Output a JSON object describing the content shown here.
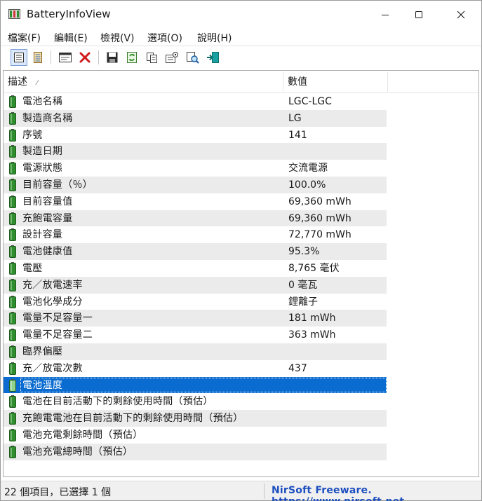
{
  "window": {
    "title": "BatteryInfoView",
    "app_icon": "battery-app-icon",
    "controls": [
      "minimize-icon",
      "maximize-icon",
      "close-icon"
    ]
  },
  "menu": {
    "items": [
      "檔案(F)",
      "編輯(E)",
      "檢視(V)",
      "選項(O)",
      "說明(H)"
    ]
  },
  "toolbar": {
    "buttons": [
      {
        "icon": "battery-info-mode-icon",
        "active": true
      },
      {
        "icon": "battery-log-mode-icon",
        "active": false
      },
      {
        "icon": "properties-window-icon",
        "active": false
      },
      {
        "icon": "delete-x-icon",
        "active": false
      },
      {
        "icon": "save-floppy-icon",
        "active": false
      },
      {
        "icon": "refresh-icon",
        "active": false
      },
      {
        "icon": "copy-icon",
        "active": false
      },
      {
        "icon": "properties-icon",
        "active": false
      },
      {
        "icon": "find-icon",
        "active": false
      },
      {
        "icon": "exit-icon",
        "active": false
      }
    ]
  },
  "list": {
    "columns": [
      "描述",
      "數值"
    ],
    "sort_indicator": "⁄",
    "rows": [
      {
        "desc": "電池名稱",
        "value": "LGC-LGC"
      },
      {
        "desc": "製造商名稱",
        "value": " LG"
      },
      {
        "desc": "序號",
        "value": "141"
      },
      {
        "desc": "製造日期",
        "value": ""
      },
      {
        "desc": "電源狀態",
        "value": "交流電源"
      },
      {
        "desc": "目前容量（％）",
        "value": "100.0%"
      },
      {
        "desc": "目前容量值",
        "value": "69,360 mWh"
      },
      {
        "desc": "充飽電容量",
        "value": "69,360 mWh"
      },
      {
        "desc": "設計容量",
        "value": "72,770 mWh"
      },
      {
        "desc": "電池健康值",
        "value": "95.3%"
      },
      {
        "desc": "電壓",
        "value": "8,765 毫伏"
      },
      {
        "desc": "充／放電速率",
        "value": "0 毫瓦"
      },
      {
        "desc": "電池化學成分",
        "value": "鋰離子"
      },
      {
        "desc": "電量不足容量一",
        "value": "181 mWh"
      },
      {
        "desc": "電量不足容量二",
        "value": "363 mWh"
      },
      {
        "desc": "臨界偏壓",
        "value": ""
      },
      {
        "desc": "充／放電次數",
        "value": "437"
      },
      {
        "desc": "電池溫度",
        "value": "",
        "selected": true
      },
      {
        "desc": "電池在目前活動下的剩餘使用時間（預估）",
        "value": ""
      },
      {
        "desc": "充飽電電池在目前活動下的剩餘使用時間（預估）",
        "value": ""
      },
      {
        "desc": "電池充電剩餘時間（預估）",
        "value": ""
      },
      {
        "desc": "電池充電總時間（預估）",
        "value": ""
      }
    ]
  },
  "status": {
    "items": "22 個項目，已選擇 1 個",
    "credit": "NirSoft Freeware.  https://www.nirsoft.net"
  },
  "colors": {
    "selection": "#0a6cd0",
    "battery_green": "#2f8f2f",
    "credit_link": "#1d4fbf"
  }
}
